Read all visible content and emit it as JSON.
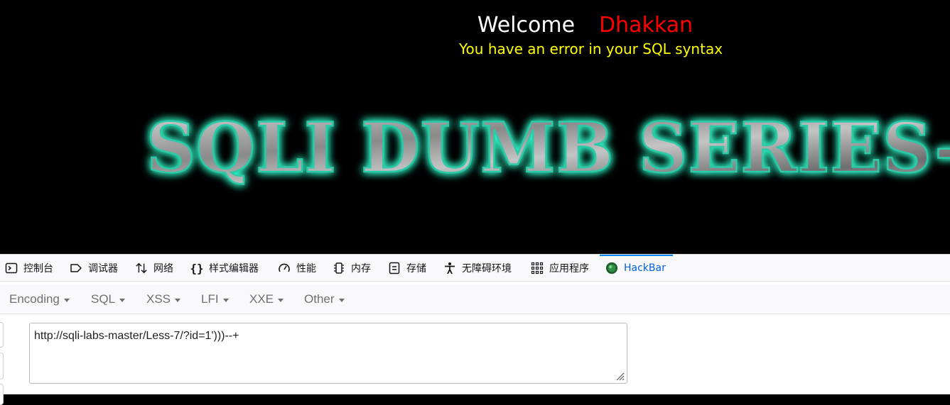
{
  "page": {
    "welcome": "Welcome",
    "username": "Dhakkan",
    "error": "You have an error in your SQL syntax",
    "banner": "SQLI DUMB SERIES-"
  },
  "devtools": {
    "tabs": [
      {
        "label": "控制台",
        "icon": "console-icon"
      },
      {
        "label": "调试器",
        "icon": "debugger-icon"
      },
      {
        "label": "网络",
        "icon": "network-icon"
      },
      {
        "label": "样式编辑器",
        "icon": "style-editor-icon"
      },
      {
        "label": "性能",
        "icon": "performance-icon"
      },
      {
        "label": "内存",
        "icon": "memory-icon"
      },
      {
        "label": "存储",
        "icon": "storage-icon"
      },
      {
        "label": "无障碍环境",
        "icon": "accessibility-icon"
      },
      {
        "label": "应用程序",
        "icon": "application-icon"
      },
      {
        "label": "HackBar",
        "icon": "hackbar-icon"
      }
    ],
    "active_tab": "HackBar"
  },
  "hackbar": {
    "menus": [
      "Encoding",
      "SQL",
      "XSS",
      "LFI",
      "XXE",
      "Other"
    ],
    "url": "http://sqli-labs-master/Less-7/?id=1')))--+"
  },
  "colors": {
    "page_bg": "#000000",
    "welcome": "#ffffff",
    "username": "#ff0000",
    "error": "#ffff00",
    "banner_glow": "#33ffcc",
    "active_tab": "#0061e0"
  }
}
